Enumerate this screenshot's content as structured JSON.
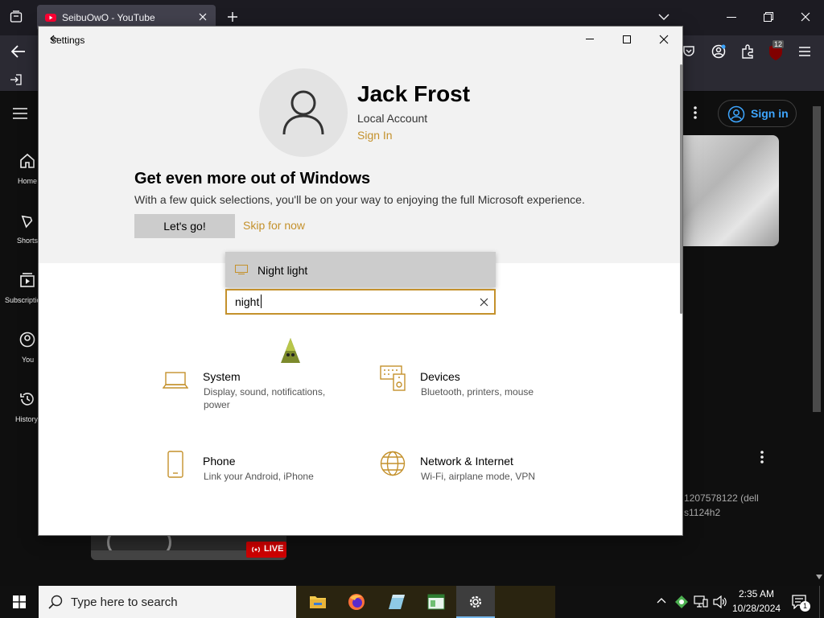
{
  "browser": {
    "tab_title": "SeibuOwO - YouTube",
    "notification_count": "12",
    "sidebar": [
      {
        "label": "Home"
      },
      {
        "label": "Shorts"
      },
      {
        "label": "Subscriptions"
      },
      {
        "label": "You"
      },
      {
        "label": "History"
      }
    ],
    "sign_in_label": "Sign in",
    "live_label": "LIVE",
    "side_text_1": "1207578122 (dell",
    "side_text_2": "s1124h2"
  },
  "settings": {
    "window_title": "Settings",
    "user_name": "Jack Frost",
    "account_type": "Local Account",
    "sign_in_link": "Sign In",
    "promo_title": "Get even more out of Windows",
    "promo_text": "With a few quick selections, you'll be on your way to enjoying the full Microsoft experience.",
    "lets_go_label": "Let's go!",
    "skip_label": "Skip for now",
    "search": {
      "value": "night",
      "suggestion": "Night light"
    },
    "categories": [
      {
        "title": "System",
        "desc": "Display, sound, notifications, power",
        "icon": "laptop-icon"
      },
      {
        "title": "Devices",
        "desc": "Bluetooth, printers, mouse",
        "icon": "keyboard-speaker-icon"
      },
      {
        "title": "Phone",
        "desc": "Link your Android, iPhone",
        "icon": "phone-icon"
      },
      {
        "title": "Network & Internet",
        "desc": "Wi-Fi, airplane mode, VPN",
        "icon": "globe-icon"
      }
    ],
    "accent_color": "#c4912c"
  },
  "taskbar": {
    "search_placeholder": "Type here to search",
    "time": "2:35 AM",
    "date": "10/28/2024",
    "notification_count": "1"
  }
}
